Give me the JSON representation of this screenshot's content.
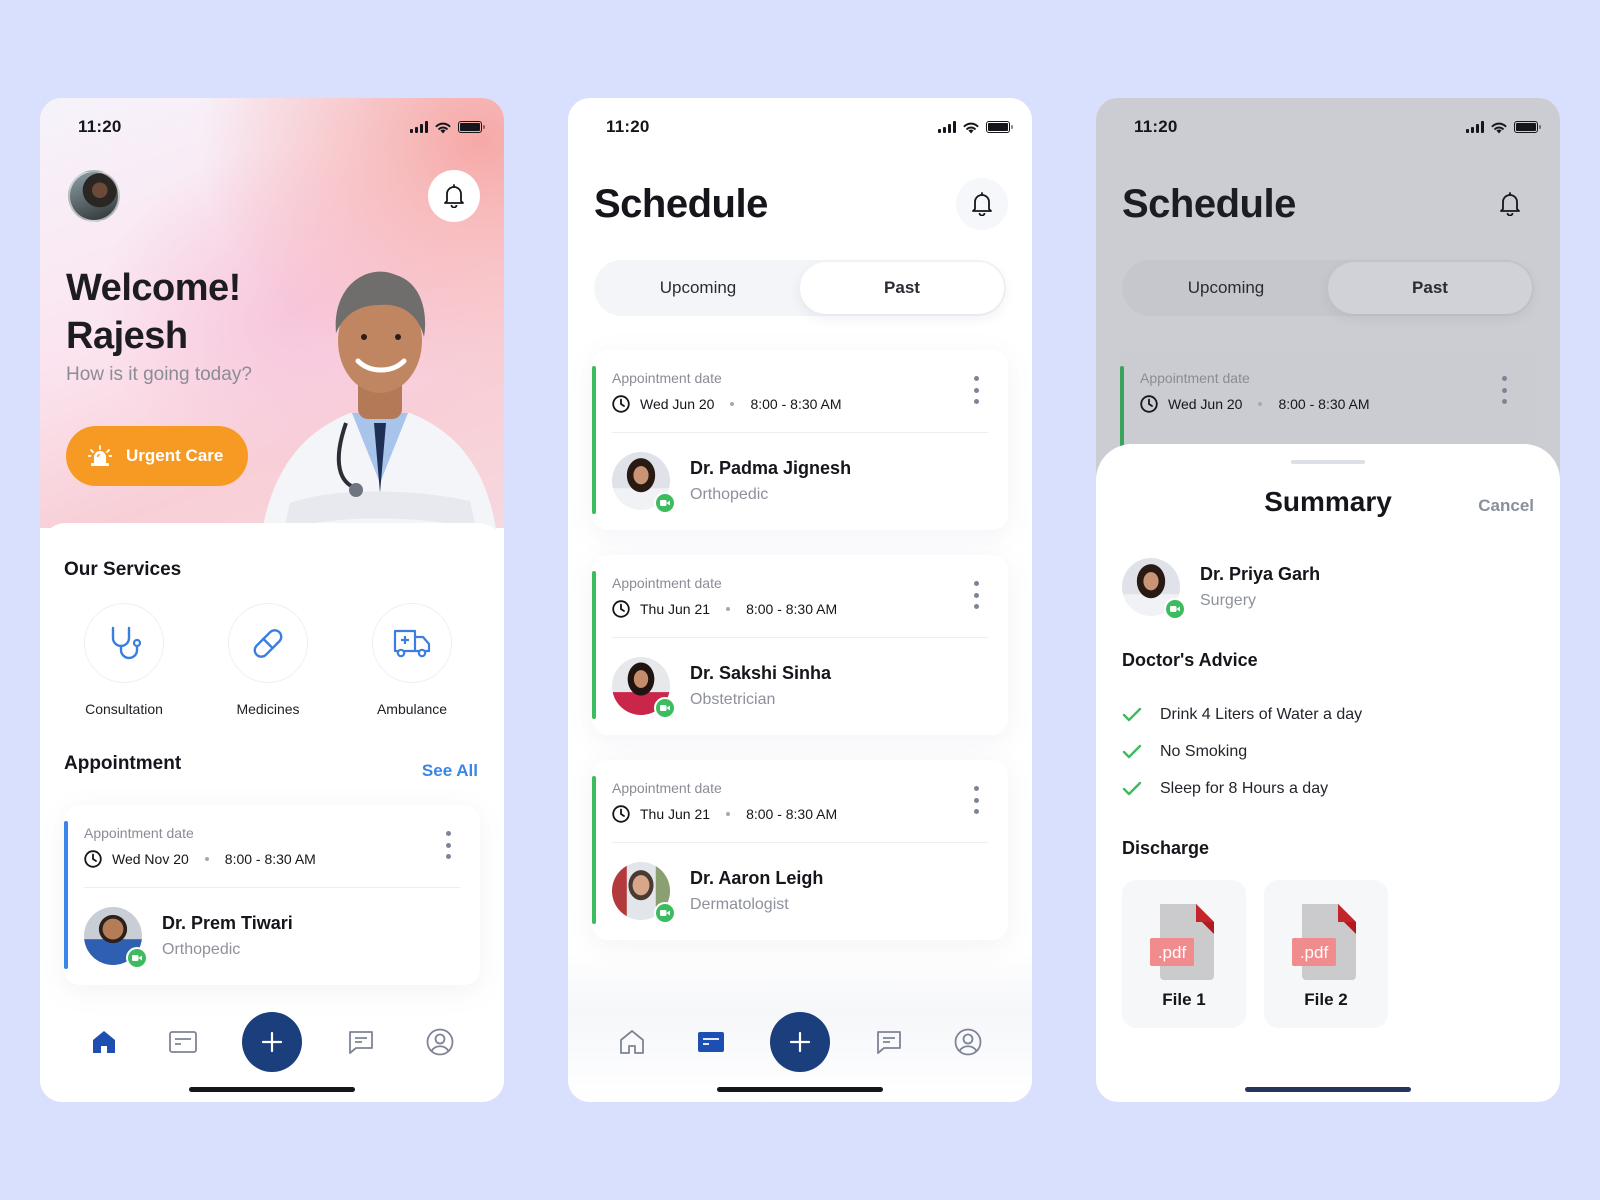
{
  "status_bar": {
    "time": "11:20"
  },
  "home": {
    "greeting_line1": "Welcome!",
    "greeting_line2": "Rajesh",
    "subtitle": "How is it going today?",
    "urgent_button": "Urgent Care",
    "services_title": "Our Services",
    "services": [
      {
        "label": "Consultation",
        "icon": "stethoscope-icon"
      },
      {
        "label": "Medicines",
        "icon": "pill-icon"
      },
      {
        "label": "Ambulance",
        "icon": "ambulance-icon"
      }
    ],
    "appointment_title": "Appointment",
    "see_all": "See All",
    "appointment": {
      "label": "Appointment date",
      "date": "Wed Nov 20",
      "time": "8:00 - 8:30 AM",
      "doctor": "Dr. Prem Tiwari",
      "specialty": "Orthopedic"
    }
  },
  "schedule": {
    "title": "Schedule",
    "tabs": [
      {
        "label": "Upcoming",
        "active": false
      },
      {
        "label": "Past",
        "active": true
      }
    ],
    "appointments": [
      {
        "label": "Appointment date",
        "date": "Wed Jun 20",
        "time": "8:00 - 8:30 AM",
        "doctor": "Dr. Padma Jignesh",
        "specialty": "Orthopedic"
      },
      {
        "label": "Appointment date",
        "date": "Thu Jun 21",
        "time": "8:00 - 8:30 AM",
        "doctor": "Dr. Sakshi Sinha",
        "specialty": "Obstetrician"
      },
      {
        "label": "Appointment date",
        "date": "Thu Jun 21",
        "time": "8:00 - 8:30 AM",
        "doctor": "Dr. Aaron Leigh",
        "specialty": "Dermatologist"
      }
    ]
  },
  "summary": {
    "background_title": "Schedule",
    "background_tabs": [
      {
        "label": "Upcoming"
      },
      {
        "label": "Past"
      }
    ],
    "background_appointment": {
      "label": "Appointment date",
      "date": "Wed Jun 20",
      "time": "8:00 - 8:30 AM"
    },
    "title": "Summary",
    "cancel": "Cancel",
    "doctor": "Dr. Priya Garh",
    "specialty": "Surgery",
    "advice_title": "Doctor's Advice",
    "advice": [
      "Drink 4 Liters of Water a day",
      "No Smoking",
      "Sleep for 8 Hours a day"
    ],
    "discharge_title": "Discharge",
    "files": [
      {
        "name": "File 1",
        "type": ".pdf"
      },
      {
        "name": "File 2",
        "type": ".pdf"
      }
    ]
  },
  "nav": {
    "items": [
      "home-icon",
      "calendar-card-icon",
      "plus-icon",
      "chat-icon",
      "profile-icon"
    ],
    "home_active": "home",
    "schedule_active": "schedule"
  },
  "colors": {
    "background": "#d9e0fd",
    "accent_orange": "#f79a24",
    "primary_navy": "#1b3e7c",
    "link_blue": "#3a86e8",
    "success_green": "#3dbb5f",
    "appointment_accent_blue": "#3a86e8",
    "appointment_accent_green": "#3dbb5f"
  }
}
